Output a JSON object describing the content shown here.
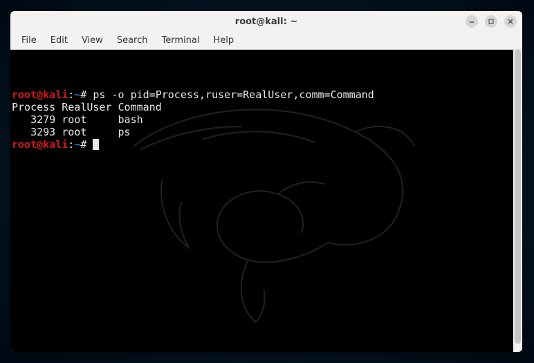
{
  "window": {
    "title": "root@kali: ~"
  },
  "menubar": {
    "items": [
      "File",
      "Edit",
      "View",
      "Search",
      "Terminal",
      "Help"
    ]
  },
  "prompt": {
    "user": "root",
    "at": "@",
    "host": "kali",
    "sep": ":",
    "path": "~",
    "sigil": "#"
  },
  "terminal": {
    "command": "ps -o pid=Process,ruser=RealUser,comm=Command",
    "header": "Process RealUser Command",
    "rows": [
      "   3279 root     bash",
      "   3293 root     ps"
    ]
  }
}
